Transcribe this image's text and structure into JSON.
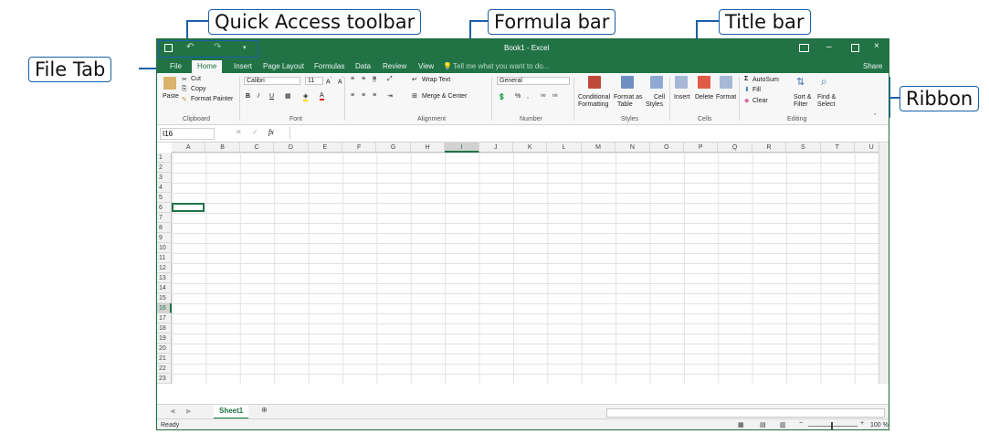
{
  "callouts": {
    "quick_access": "Quick Access toolbar",
    "formula_bar": "Formula bar",
    "title_bar": "Title bar",
    "file_tab": "File Tab",
    "ribbon": "Ribbon"
  },
  "window": {
    "title": "Book1 - Excel",
    "accent": "#217346"
  },
  "tabs": {
    "file": "File",
    "home": "Home",
    "insert": "Insert",
    "page_layout": "Page Layout",
    "formulas": "Formulas",
    "data": "Data",
    "review": "Review",
    "view": "View",
    "tell_me": "Tell me what you want to do...",
    "share": "Share"
  },
  "ribbon": {
    "clipboard": {
      "paste": "Paste",
      "cut": "Cut",
      "copy": "Copy",
      "format_painter": "Format Painter",
      "label": "Clipboard"
    },
    "font": {
      "name": "Calibri",
      "size": "11",
      "label": "Font",
      "bold": "B",
      "italic": "I",
      "underline": "U"
    },
    "alignment": {
      "wrap_text": "Wrap Text",
      "merge_center": "Merge & Center",
      "label": "Alignment"
    },
    "number": {
      "format": "General",
      "percent": "%",
      "comma": ",",
      "label": "Number"
    },
    "styles": {
      "conditional": "Conditional",
      "formatting": "Formatting",
      "format_as": "Format as",
      "table": "Table",
      "cell": "Cell",
      "styles": "Styles",
      "label": "Styles"
    },
    "cells": {
      "insert": "Insert",
      "delete": "Delete",
      "format": "Format",
      "label": "Cells"
    },
    "editing": {
      "autosum": "AutoSum",
      "fill": "Fill",
      "clear": "Clear",
      "sort_filter": "Sort &",
      "filter": "Filter",
      "find_select": "Find &",
      "select": "Select",
      "label": "Editing"
    }
  },
  "formula_bar": {
    "name_box": "I16",
    "fx": "fx"
  },
  "grid": {
    "columns": [
      "A",
      "B",
      "C",
      "D",
      "E",
      "F",
      "G",
      "H",
      "I",
      "J",
      "K",
      "L",
      "M",
      "N",
      "O",
      "P",
      "Q",
      "R",
      "S",
      "T",
      "U"
    ],
    "rows": [
      "1",
      "2",
      "3",
      "4",
      "5",
      "6",
      "7",
      "8",
      "9",
      "10",
      "11",
      "12",
      "13",
      "14",
      "15",
      "16",
      "17",
      "18",
      "19",
      "20",
      "21",
      "22",
      "23"
    ],
    "selected_column": "I",
    "selected_row": "16"
  },
  "sheets": {
    "active": "Sheet1"
  },
  "status": {
    "ready": "Ready",
    "zoom": "100 %"
  }
}
